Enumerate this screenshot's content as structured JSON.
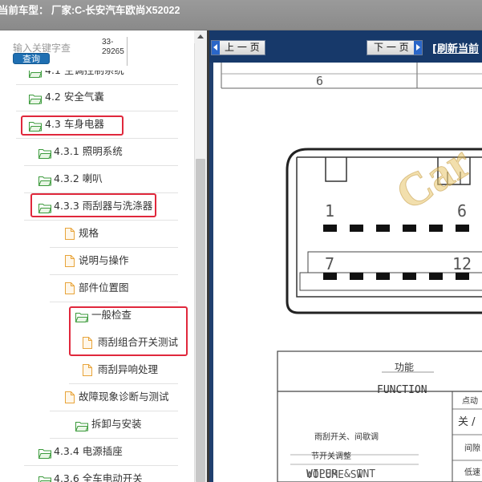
{
  "top_bar": {
    "title": "当前车型： 厂家:C-长安汽车欧尚X52022"
  },
  "search": {
    "placeholder": "输入关键字查",
    "button_label": "查询",
    "count_line1": "33-",
    "count_line2": "29265"
  },
  "tree": {
    "items": [
      {
        "label": "4.1 空调控制系统",
        "icon": "folder-open-icon"
      },
      {
        "label": "4.2 安全气囊",
        "icon": "folder-open-icon"
      },
      {
        "label": "4.3 车身电器",
        "icon": "folder-open-icon"
      },
      {
        "label": "4.3.1 照明系统",
        "icon": "folder-open-icon"
      },
      {
        "label": "4.3.2 喇叭",
        "icon": "folder-open-icon"
      },
      {
        "label": "4.3.3 雨刮器与洗涤器",
        "icon": "folder-open-icon"
      },
      {
        "label": "规格",
        "icon": "document-icon"
      },
      {
        "label": "说明与操作",
        "icon": "document-icon"
      },
      {
        "label": "部件位置图",
        "icon": "document-icon"
      },
      {
        "label": "一般检查",
        "icon": "folder-open-icon"
      },
      {
        "label": "雨刮组合开关测试",
        "icon": "document-icon"
      },
      {
        "label": "雨刮异响处理",
        "icon": "document-icon"
      },
      {
        "label": "故障现象诊断与测试",
        "icon": "document-icon"
      },
      {
        "label": "拆卸与安装",
        "icon": "folder-open-icon"
      },
      {
        "label": "4.3.4 电源插座",
        "icon": "folder-open-icon"
      },
      {
        "label": "4.3.6 全车电动开关",
        "icon": "folder-open-icon"
      }
    ]
  },
  "viewer": {
    "prev_label": "上 一 页",
    "next_label": "下 一 页",
    "refresh_label": "[刷新当前"
  },
  "document": {
    "pin_top": "6",
    "pin_1": "1",
    "pin_6": "6",
    "pin_7": "7",
    "pin_12": "12",
    "watermark": "Car",
    "table_title_cn": "功能",
    "table_title_en": "FUNCTION",
    "row1_cn": "雨刮开关、间歇调",
    "row1_cn2": "节开关调整",
    "row1_en1": "WIPER & INT",
    "row1_en2": "VOLUME SW",
    "col_a": "点动",
    "col_b": "关 /",
    "col_c": "间隙",
    "col_d": "低速"
  },
  "colors": {
    "accent_red": "#e0283c",
    "folder_green": "#3b9a3b",
    "doc_yellow": "#e8a43a",
    "nav_blue": "#17396a"
  }
}
